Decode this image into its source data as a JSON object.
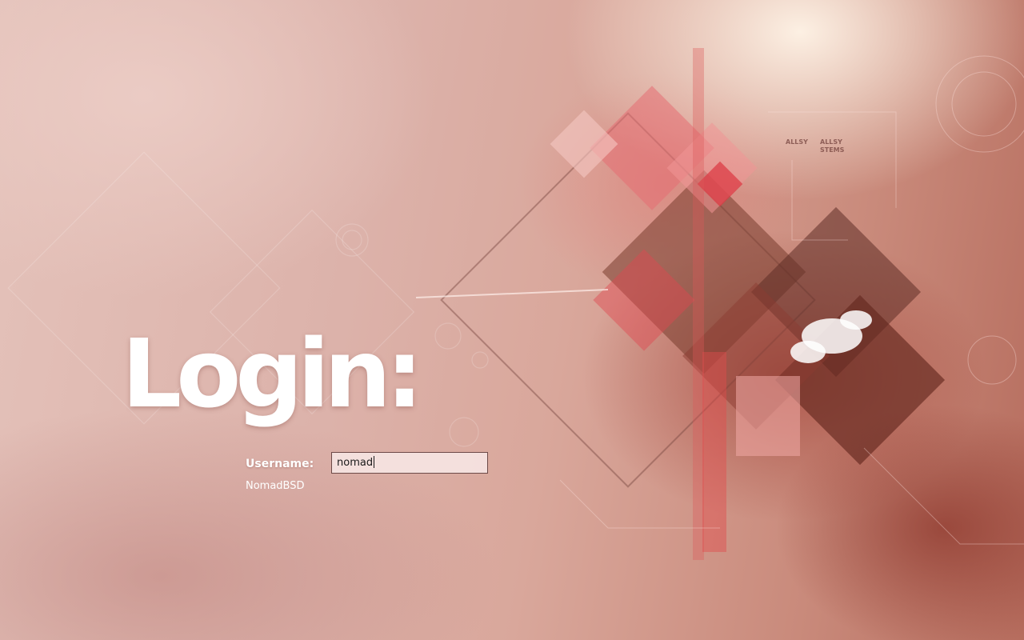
{
  "login": {
    "title": "Login:",
    "username_label": "Username:",
    "username_value": "nomad",
    "session_name": "NomadBSD"
  },
  "wallpaper": {
    "logo_text_lines": [
      "ALLSY",
      "ALLSY",
      "STEMS"
    ],
    "colors": {
      "light": "#e4c2ba",
      "mid": "#d9a79b",
      "dark": "#b66d5e",
      "accent_red": "#e0505a"
    }
  }
}
